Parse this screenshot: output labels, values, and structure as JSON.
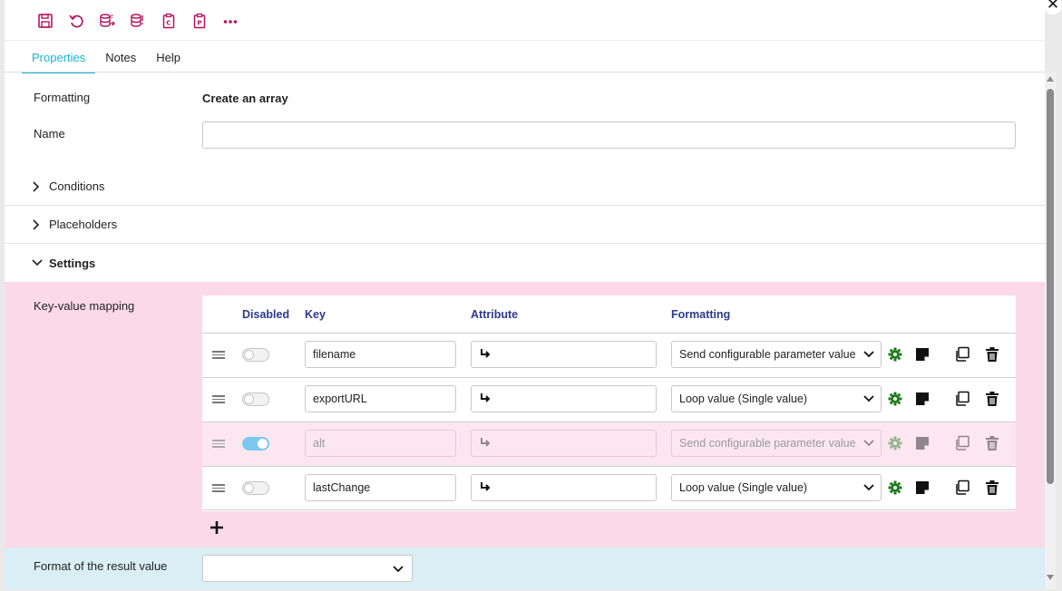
{
  "toolbar": {
    "buttons": [
      "save-icon",
      "undo-icon",
      "export-list-icon",
      "database-import-icon",
      "clipboard-c-icon",
      "clipboard-p-icon",
      "more-icon"
    ],
    "accent": "#b5135e"
  },
  "tabs": [
    {
      "label": "Properties",
      "active": true
    },
    {
      "label": "Notes",
      "active": false
    },
    {
      "label": "Help",
      "active": false
    }
  ],
  "form": {
    "formatting_label": "Formatting",
    "formatting_value": "Create an array",
    "name_label": "Name",
    "name_value": ""
  },
  "sections": {
    "conditions": "Conditions",
    "placeholders": "Placeholders",
    "settings": "Settings"
  },
  "mapping": {
    "label": "Key-value mapping",
    "headers": {
      "disabled": "Disabled",
      "key": "Key",
      "attribute": "Attribute",
      "formatting": "Formatting"
    },
    "rows": [
      {
        "key": "filename",
        "attribute": "",
        "formatting": "Send configurable parameter value",
        "disabled": false
      },
      {
        "key": "exportURL",
        "attribute": "",
        "formatting": "Loop value (Single value)",
        "disabled": false
      },
      {
        "key": "alt",
        "attribute": "",
        "formatting": "Send configurable parameter value",
        "disabled": true
      },
      {
        "key": "lastChange",
        "attribute": "",
        "formatting": "Loop value (Single value)",
        "disabled": false
      }
    ]
  },
  "result": {
    "label": "Format of the result value",
    "value": ""
  },
  "colors": {
    "settings_bg": "#fcd9e8",
    "result_bg": "#daeef6",
    "tab_active": "#1bb3d4",
    "header_text": "#2d3a8c",
    "gear_green": "#1f7a1f"
  }
}
